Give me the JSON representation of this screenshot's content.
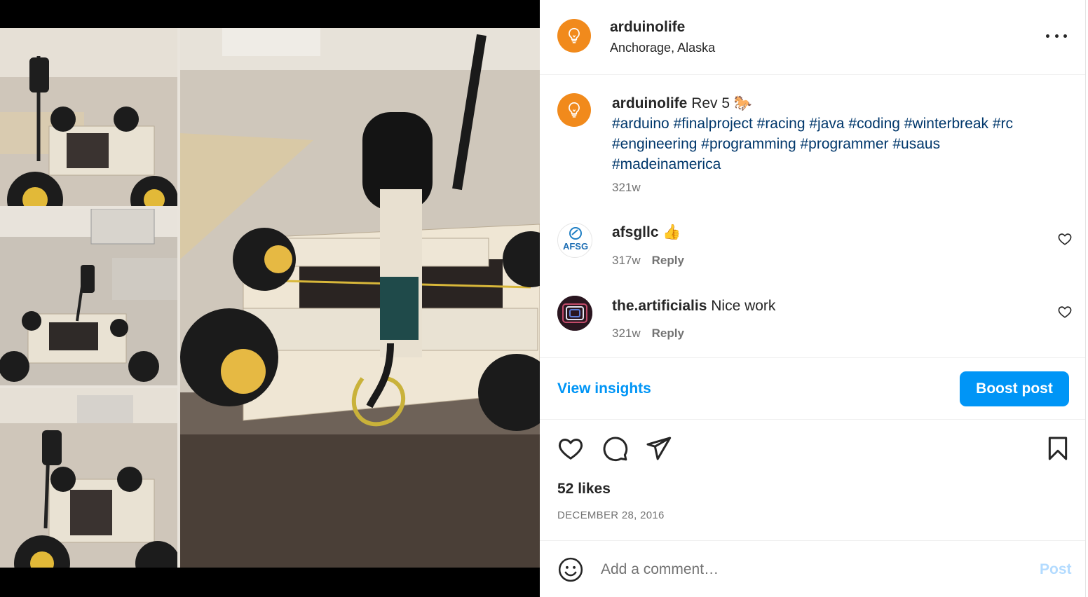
{
  "post": {
    "username": "arduinolife",
    "location": "Anchorage, Alaska",
    "more_icon": "more-horizontal-icon",
    "avatar_icon": "lightbulb-icon",
    "avatar_color": "#f18a1c"
  },
  "caption": {
    "username": "arduinolife",
    "text": "Rev 5 🐎",
    "hashtags_line1": "#arduino #finalproject #racing #java #coding #winterbreak #rc",
    "hashtags_line2": "#engineering #programming #programmer #usaus",
    "hashtags_line3": "#madeinamerica",
    "age": "321w"
  },
  "comments": [
    {
      "username": "afsgllc",
      "text": "👍",
      "age": "317w",
      "reply_label": "Reply",
      "avatar_text": "AFSG"
    },
    {
      "username": "the.artificialis",
      "text": "Nice work",
      "age": "321w",
      "reply_label": "Reply"
    }
  ],
  "insights": {
    "view_label": "View insights",
    "boost_label": "Boost post"
  },
  "actions": {
    "like_icon": "heart-icon",
    "comment_icon": "comment-icon",
    "share_icon": "send-icon",
    "save_icon": "bookmark-icon"
  },
  "likes": "52 likes",
  "date": "DECEMBER 28, 2016",
  "comment_box": {
    "placeholder": "Add a comment…",
    "post_label": "Post"
  },
  "colors": {
    "accent": "#0095f6",
    "hashtag": "#00376b",
    "muted": "#737373"
  }
}
